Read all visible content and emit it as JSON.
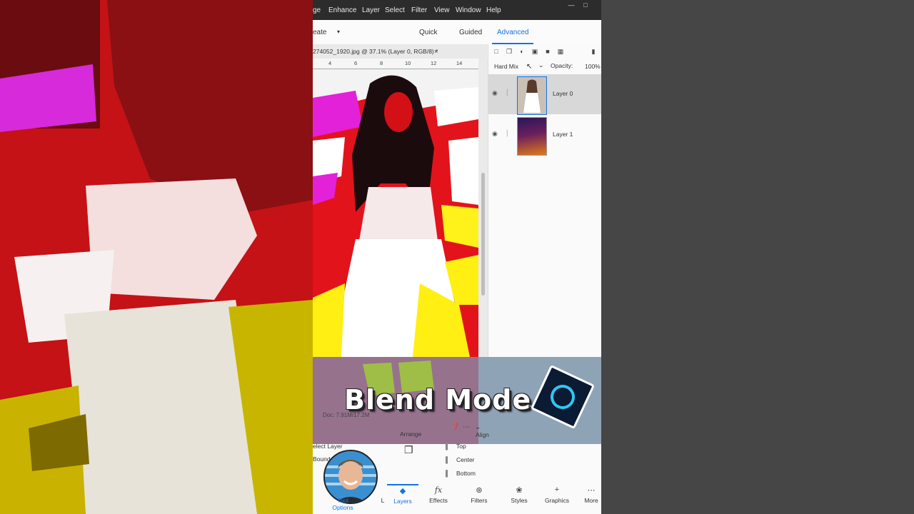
{
  "menubar": {
    "items": [
      "ge",
      "Enhance",
      "Layer",
      "Select",
      "Filter",
      "View",
      "Window",
      "Help"
    ]
  },
  "modebar": {
    "create_label": "eate",
    "create_chevron_icon": "caret-down-icon",
    "modes": [
      "Quick",
      "Guided",
      "Advanced"
    ],
    "active_mode": "Advanced",
    "active_color": "#1473e6"
  },
  "document": {
    "tab_title": "274052_1920.jpg @ 37.1% (Layer 0, RGB/8) *",
    "close_symbol": "×",
    "ruler_ticks": [
      "4",
      "6",
      "8",
      "10",
      "12",
      "14"
    ]
  },
  "layers_panel": {
    "toolbar_icons": [
      "new-layer-icon",
      "group-icon",
      "adjustment-icon",
      "mask-icon",
      "lock-icon",
      "lock-all-icon",
      "trash-icon"
    ],
    "blend_mode": "Hard Mix",
    "opacity_label": "Opacity:",
    "opacity_value": "100%",
    "layers": [
      {
        "name": "Layer 0",
        "selected": true
      },
      {
        "name": "Layer 1",
        "selected": false
      }
    ]
  },
  "status": {
    "doc_size": "Doc: 7.91M/17.2M"
  },
  "tool_options": {
    "arrange_label": "Arrange",
    "align_label": "Align",
    "select_layer": "elect Layer",
    "bounds": "Bound",
    "align_items": [
      "Top",
      "Center",
      "Bottom"
    ]
  },
  "bottom_tabs": [
    {
      "label": "Tool Options",
      "icon": "tool-options-icon",
      "active": true
    },
    {
      "label": "L",
      "icon": "",
      "active": false
    },
    {
      "label": "Layers",
      "icon": "layers-icon",
      "active": true
    },
    {
      "label": "Effects",
      "icon": "fx-icon",
      "active": false
    },
    {
      "label": "Filters",
      "icon": "filters-icon",
      "active": false
    },
    {
      "label": "Styles",
      "icon": "styles-icon",
      "active": false
    },
    {
      "label": "Graphics",
      "icon": "plus-icon",
      "active": false
    },
    {
      "label": "More",
      "icon": "more-icon",
      "active": false
    }
  ],
  "overlay": {
    "title": "Blend Mode"
  }
}
